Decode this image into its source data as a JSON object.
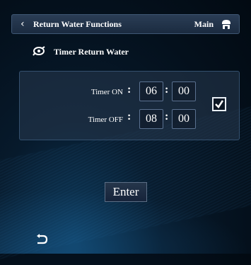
{
  "header": {
    "title": "Return Water Functions",
    "main_label": "Main"
  },
  "section": {
    "title": "Timer Return Water",
    "icon": "pump-icon"
  },
  "timer_on": {
    "label": "Timer ON",
    "colon": ":",
    "hour": "06",
    "minute": "00"
  },
  "timer_off": {
    "label": "Timer OFF",
    "colon": ":",
    "hour": "08",
    "minute": "00"
  },
  "checkbox": {
    "checked": true
  },
  "enter_label": "Enter",
  "icons": [
    "back-icon",
    "home-icon",
    "pump-icon",
    "check-icon",
    "return-icon"
  ]
}
